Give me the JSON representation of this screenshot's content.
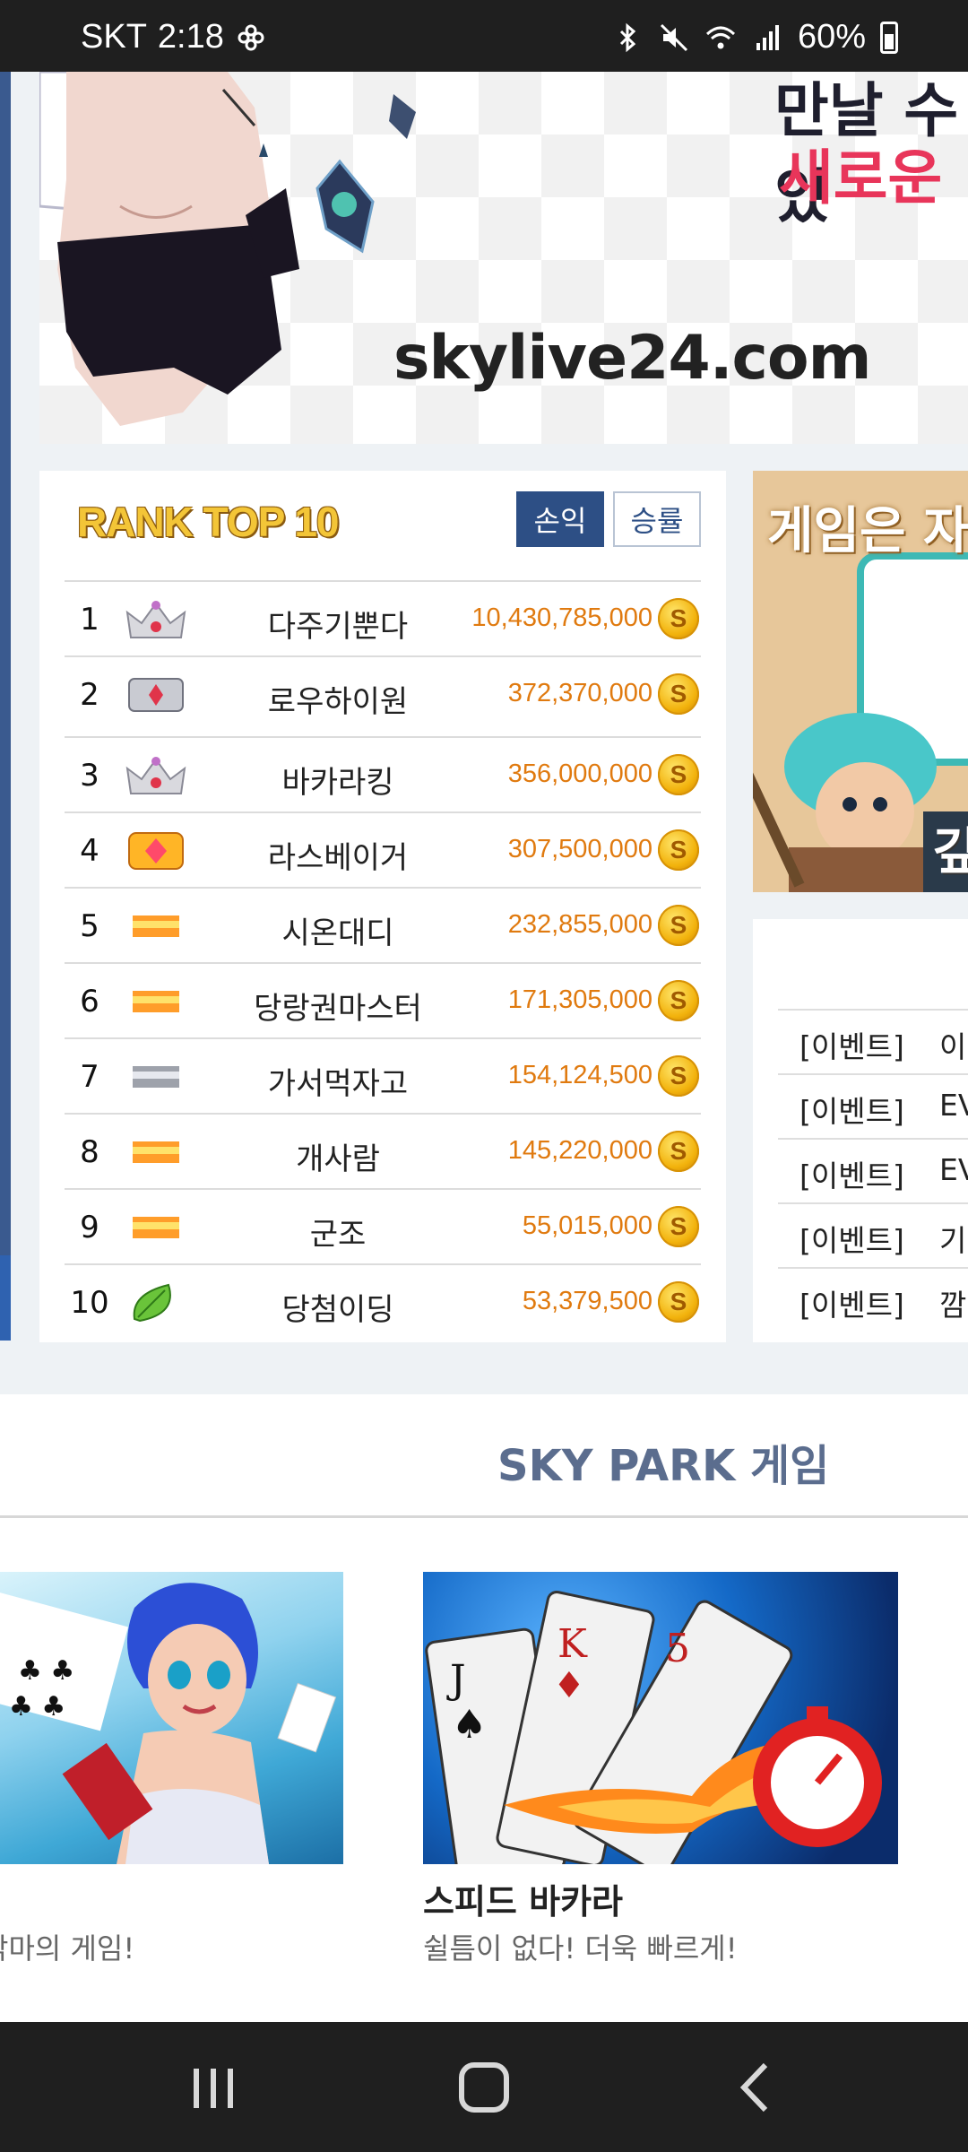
{
  "status_bar": {
    "carrier": "SKT",
    "time": "2:18",
    "battery": "60%"
  },
  "banner": {
    "url": "skylive24.com",
    "headline_partial": "만날 수 있",
    "subhead_partial": "새로운 "
  },
  "rank": {
    "title": "RANK TOP 10",
    "tabs": {
      "profit": "손익",
      "winrate": "승률"
    },
    "active_tab": "profit",
    "coin_symbol": "S",
    "rows": [
      {
        "num": "1",
        "name": "다주기뿐다",
        "amount": "10,430,785,000",
        "badge": "crown"
      },
      {
        "num": "2",
        "name": "로우하이원",
        "amount": "372,370,000",
        "badge": "silver-emblem"
      },
      {
        "num": "3",
        "name": "바카라킹",
        "amount": "356,000,000",
        "badge": "crown"
      },
      {
        "num": "4",
        "name": "라스베이거",
        "amount": "307,500,000",
        "badge": "gold-emblem"
      },
      {
        "num": "5",
        "name": "시온대디",
        "amount": "232,855,000",
        "badge": "gold-bar"
      },
      {
        "num": "6",
        "name": "당랑권마스터",
        "amount": "171,305,000",
        "badge": "gold-bar"
      },
      {
        "num": "7",
        "name": "가서먹자고",
        "amount": "154,124,500",
        "badge": "silver-bar"
      },
      {
        "num": "8",
        "name": "개사람",
        "amount": "145,220,000",
        "badge": "gold-bar"
      },
      {
        "num": "9",
        "name": "군조",
        "amount": "55,015,000",
        "badge": "gold-bar"
      },
      {
        "num": "10",
        "name": "당첨이딩",
        "amount": "53,379,500",
        "badge": "leaf"
      }
    ]
  },
  "promo": {
    "text": "게임은 자",
    "text2": "깊"
  },
  "events": [
    {
      "tag": "[이벤트]",
      "title": "이"
    },
    {
      "tag": "[이벤트]",
      "title": "EV"
    },
    {
      "tag": "[이벤트]",
      "title": "EV"
    },
    {
      "tag": "[이벤트]",
      "title": "기"
    },
    {
      "tag": "[이벤트]",
      "title": "깜"
    }
  ],
  "games": {
    "title": "SKY PARK 게임",
    "items": [
      {
        "name": "",
        "desc": "악마의 게임!"
      },
      {
        "name": "스피드 바카라",
        "desc": "쉴틈이 없다! 더욱 빠르게!"
      }
    ]
  }
}
